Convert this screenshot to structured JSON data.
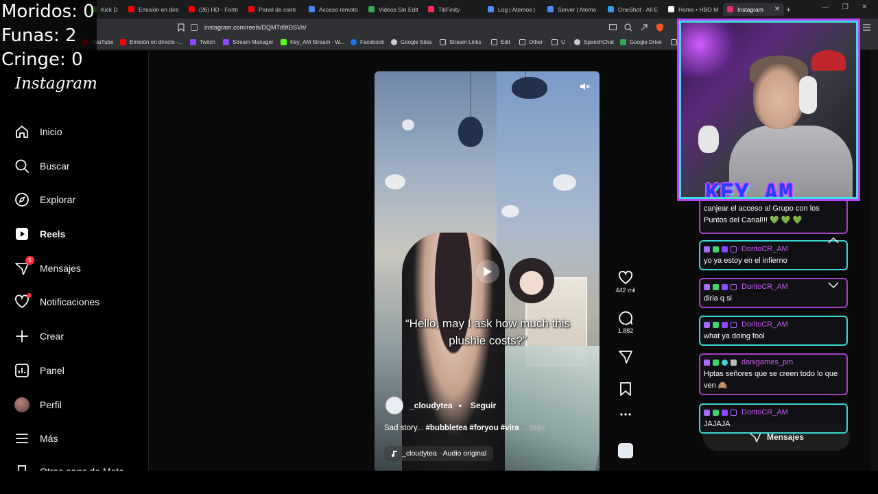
{
  "browser": {
    "tabs": [
      {
        "label": "Kick D",
        "color": "#53fc18"
      },
      {
        "label": "Emisión en dire",
        "color": "#ff0000"
      },
      {
        "label": "(26) HD - Fortn",
        "color": "#ff0000"
      },
      {
        "label": "Panel de contr",
        "color": "#ff0000"
      },
      {
        "label": "Acceso remoto",
        "color": "#4285f4"
      },
      {
        "label": "Videos Sin Edit",
        "color": "#34a853"
      },
      {
        "label": "TikFinity",
        "color": "#ff2b55"
      },
      {
        "label": "Log | Atemos |",
        "color": "#4b8cf5"
      },
      {
        "label": "Server | Atemo",
        "color": "#4b8cf5"
      },
      {
        "label": "OneShot - All E",
        "color": "#2f9ee8"
      },
      {
        "label": "Home • HBO M",
        "color": "#ffffff"
      },
      {
        "label": "Instagram",
        "color": "#e1306c",
        "active": true
      }
    ],
    "new_tab": "+",
    "url": "instagram.com/reels/DQMTd9tDSVh/",
    "bookmarks": [
      {
        "label": "YouTube",
        "color": "#ff0000"
      },
      {
        "label": "Emisión en directo -...",
        "color": "#ff0000"
      },
      {
        "label": "Twitch",
        "color": "#9146ff"
      },
      {
        "label": "Stream Manager",
        "color": "#9146ff"
      },
      {
        "label": "Key_AM Stream - W...",
        "color": "#53fc18"
      },
      {
        "label": "Facebook",
        "color": "#1877f2"
      },
      {
        "label": "Google Sites",
        "color": "#cccccc"
      },
      {
        "label": "Stream Links",
        "color": "#cccccc"
      },
      {
        "label": "Edit",
        "color": "#cccccc"
      },
      {
        "label": "Other",
        "color": "#cccccc"
      },
      {
        "label": "U",
        "color": "#cccccc"
      },
      {
        "label": "SpeechChat",
        "color": "#cccccc"
      },
      {
        "label": "Google Drive",
        "color": "#34a853"
      }
    ]
  },
  "overlay": {
    "counters": [
      "Moridos: 0",
      "Funas: 2",
      "Cringe: 0"
    ]
  },
  "sidebar": {
    "logo": "Instagram",
    "items": [
      {
        "label": "Inicio",
        "icon": "home-icon"
      },
      {
        "label": "Buscar",
        "icon": "search-icon"
      },
      {
        "label": "Explorar",
        "icon": "compass-icon"
      },
      {
        "label": "Reels",
        "icon": "reels-icon",
        "bold": true
      },
      {
        "label": "Mensajes",
        "icon": "messenger-icon",
        "badge": "5"
      },
      {
        "label": "Notificaciones",
        "icon": "heart-icon",
        "dot": true
      },
      {
        "label": "Crear",
        "icon": "plus-icon"
      },
      {
        "label": "Panel",
        "icon": "dashboard-icon"
      },
      {
        "label": "Perfil",
        "icon": "avatar-icon"
      },
      {
        "label": "Más",
        "icon": "menu-icon"
      },
      {
        "label": "Otras apps de Meta",
        "icon": "meta-apps-icon"
      }
    ]
  },
  "reel": {
    "caption": "“Hello, may I ask how much this plushie costs?”",
    "username": "_cloudytea",
    "separator": "•",
    "follow": "Seguir",
    "description_prefix": "Sad story...",
    "hashtags": "#bubbletea #foryou #vira",
    "more": "... más",
    "audio": "_cloudytea · Audio original",
    "likes": "442 mil",
    "comments": "1.882"
  },
  "chat": {
    "partial_top": "canjear el acceso al Grupo con los Puntos del Canal!!! 💚 💚 💚",
    "messages": [
      {
        "user": "DoritoCR_AM",
        "text": "yo ya estoy en el infierno",
        "style": "cyan"
      },
      {
        "user": "DoritoCR_AM",
        "text": "diria q si",
        "style": "pink"
      },
      {
        "user": "DoritoCR_AM",
        "text": "what ya doing fool",
        "style": "cyan"
      },
      {
        "user": "danigames_pm",
        "text": "Hptas señores que se creen todo lo que ven 🙈",
        "style": "pink"
      },
      {
        "user": "DoritoCR_AM",
        "text": "JAJAJA",
        "style": "cyan"
      }
    ],
    "messages_pill": "Mensajes"
  },
  "webcam": {
    "brand": "KEY_AM"
  }
}
